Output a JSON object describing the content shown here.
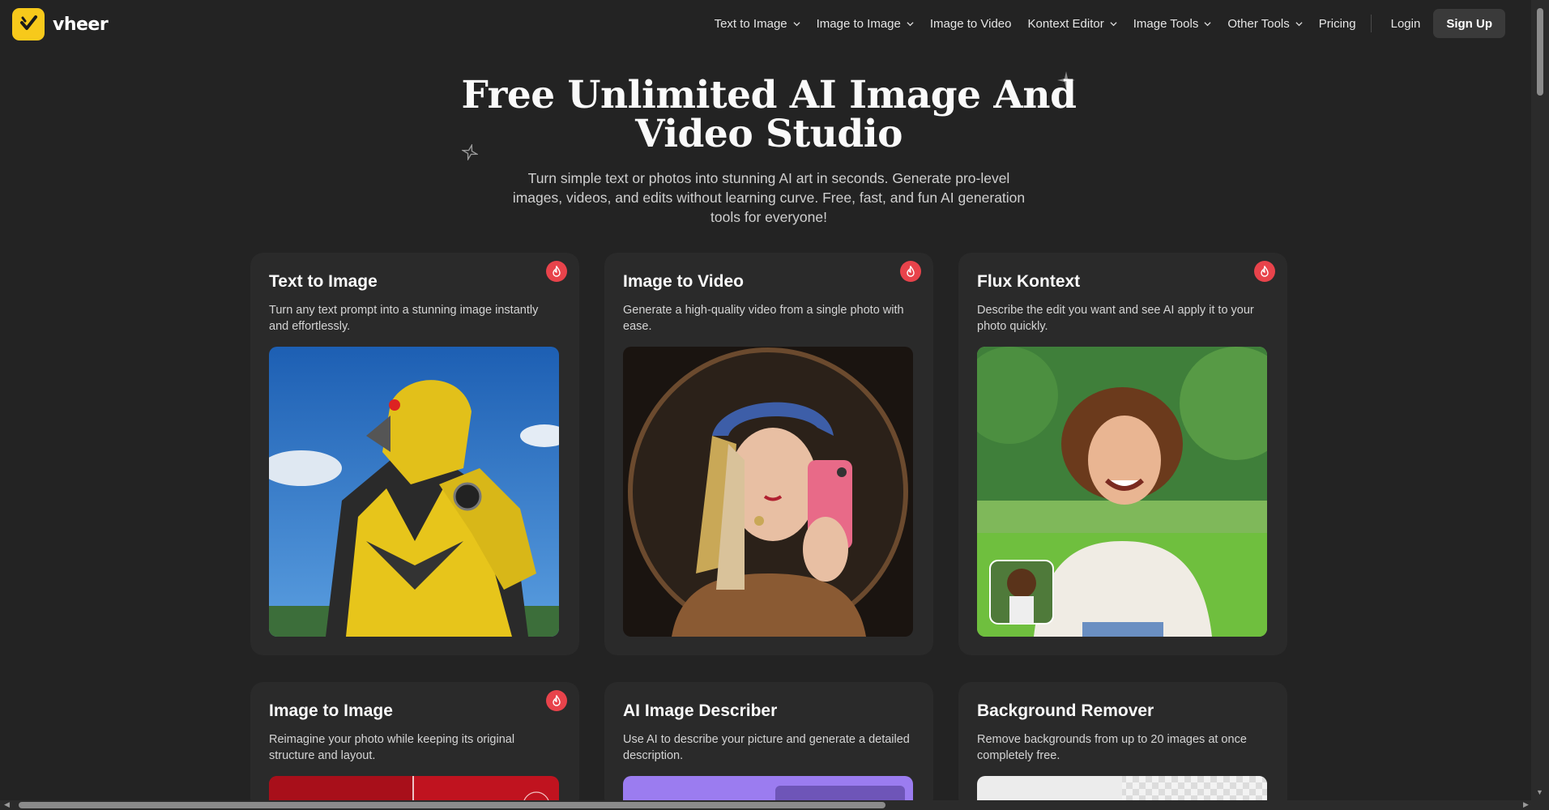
{
  "brand": {
    "name": "vheer",
    "logo_color": "#f7c91b"
  },
  "nav": {
    "items": [
      {
        "label": "Text to Image",
        "dropdown": true
      },
      {
        "label": "Image to Image",
        "dropdown": true
      },
      {
        "label": "Image to Video",
        "dropdown": false
      },
      {
        "label": "Kontext Editor",
        "dropdown": true
      },
      {
        "label": "Image Tools",
        "dropdown": true
      },
      {
        "label": "Other Tools",
        "dropdown": true
      },
      {
        "label": "Pricing",
        "dropdown": false
      }
    ],
    "login": "Login",
    "signup": "Sign Up"
  },
  "hero": {
    "title_line1": "Free Unlimited AI Image And",
    "title_line2": "Video Studio",
    "subtitle": "Turn simple text or photos into stunning AI art in seconds. Generate pro-level images, videos, and edits without learning curve. Free, fast, and fun AI generation tools for everyone!"
  },
  "cards": [
    {
      "title": "Text to Image",
      "desc": "Turn any text prompt into a stunning image instantly and effortlessly.",
      "hot": true,
      "image": "robotic-eagle-image"
    },
    {
      "title": "Image to Video",
      "desc": "Generate a high-quality video from a single photo with ease.",
      "hot": true,
      "image": "girl-with-pearl-earring-selfie-image"
    },
    {
      "title": "Flux Kontext",
      "desc": "Describe the edit you want and see AI apply it to your photo quickly.",
      "hot": true,
      "image": "anime-man-in-park-image"
    },
    {
      "title": "Image to Image",
      "desc": "Reimagine your photo while keeping its original structure and layout.",
      "hot": true,
      "image": "red-abstract-image"
    },
    {
      "title": "AI Image Describer",
      "desc": "Use AI to describe your picture and generate a detailed description.",
      "hot": false,
      "image": "purple-preview-image"
    },
    {
      "title": "Background Remover",
      "desc": "Remove backgrounds from up to 20 images at once completely free.",
      "hot": false,
      "image": "transparent-checker-image"
    }
  ],
  "colors": {
    "accent_hot": "#e8434b",
    "page_bg": "#232323",
    "card_bg": "#2a2a2a"
  }
}
